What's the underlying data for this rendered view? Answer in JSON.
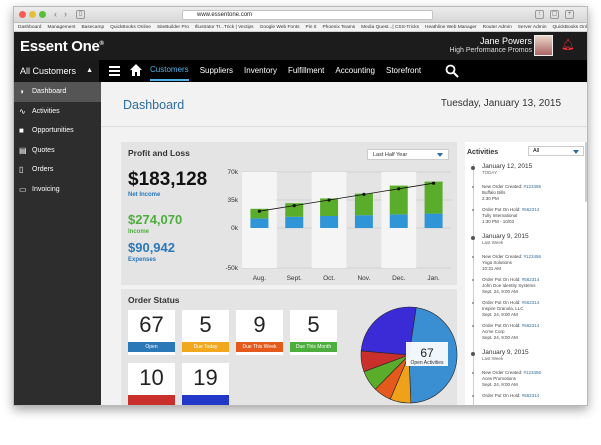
{
  "browser": {
    "url": "www.essentone.com",
    "bookmarks": [
      "Dashboard",
      "Management",
      "Basecamp",
      "QuickBooks Online",
      "SiteBuilder Pro",
      "Illustrator Tr...Trick | Vectips",
      "Google Web Fonts",
      "Pin It",
      "Phoenix Teams",
      "Media Quest...| CSS-Tricks",
      "Heathline Web Manager",
      "Router Admin",
      "Server Admin",
      "QuickBooks Online"
    ]
  },
  "header": {
    "logo": "Essent One",
    "logo_tm": "®",
    "user_name": "Jane Powers",
    "company": "High Performance Promos"
  },
  "nav": {
    "customer_select": "All Customers",
    "items": [
      {
        "label": "Customers",
        "active": true
      },
      {
        "label": "Suppliers"
      },
      {
        "label": "Inventory"
      },
      {
        "label": "Fulfillment"
      },
      {
        "label": "Accounting"
      },
      {
        "label": "Storefront"
      }
    ]
  },
  "sidebar": {
    "items": [
      {
        "label": "Dashboard",
        "icon": "dashboard-icon",
        "glyph": "◑"
      },
      {
        "label": "Activities",
        "icon": "activity-icon",
        "glyph": "∿"
      },
      {
        "label": "Opportunities",
        "icon": "briefcase-icon",
        "glyph": "■"
      },
      {
        "label": "Quotes",
        "icon": "quote-icon",
        "glyph": "▤"
      },
      {
        "label": "Orders",
        "icon": "orders-icon",
        "glyph": "▯"
      },
      {
        "label": "Invoicing",
        "icon": "invoice-icon",
        "glyph": "▭"
      }
    ]
  },
  "dashboard": {
    "title": "Dashboard",
    "date": "Tuesday, January 13, 2015"
  },
  "profit": {
    "title": "Profit and Loss",
    "period": "Last Half Year",
    "net_value": "$183,128",
    "net_label": "Net Income",
    "income_value": "$274,070",
    "income_label": "Income",
    "expense_value": "$90,942",
    "expense_label": "Expenses"
  },
  "chart_data": {
    "type": "bar",
    "categories": [
      "Aug.",
      "Sept.",
      "Oct.",
      "Nov.",
      "Dec.",
      "Jan."
    ],
    "yticks": [
      "70k",
      "35k",
      "0k",
      "-50k"
    ],
    "ylim": [
      -50,
      70
    ],
    "series": [
      {
        "name": "Expenses",
        "values": [
          12,
          14,
          15,
          16,
          17,
          18
        ]
      },
      {
        "name": "Income",
        "values": [
          12,
          17,
          22,
          27,
          36,
          40
        ]
      },
      {
        "name": "Net Income",
        "values": [
          9,
          14,
          20,
          26,
          32,
          38
        ]
      }
    ],
    "colors": {
      "income": "#5aad2b",
      "expenses": "#2f95d6",
      "net": "#111"
    }
  },
  "orders": {
    "title": "Order Status",
    "tiles": [
      {
        "n": "67",
        "label": "Open",
        "color": "#2b78b8"
      },
      {
        "n": "5",
        "label": "Due Today",
        "color": "#f2a81d"
      },
      {
        "n": "9",
        "label": "Due This Week",
        "color": "#e35a1c"
      },
      {
        "n": "5",
        "label": "Due This Month",
        "color": "#4cae3c"
      },
      {
        "n": "10",
        "label": "",
        "color": "#c9302c"
      },
      {
        "n": "19",
        "label": "",
        "color": "#2238c9"
      }
    ],
    "pie_center": {
      "n": "67",
      "label": "Open Activities"
    },
    "pie_colors": [
      "#3a8fd3",
      "#f0a11a",
      "#e35a1c",
      "#5aad2b",
      "#c9302c",
      "#3a2bd6"
    ]
  },
  "activities": {
    "title": "Activities",
    "filter": "All",
    "events": [
      {
        "date": "January 12, 2015",
        "sub": "TODAY",
        "items": [
          {
            "txt": "New Order Created: ",
            "id": "#123456",
            "meta": "Buffalo Bills",
            "time": "2:30 PM"
          },
          {
            "txt": "Order Put On Hold: ",
            "id": "#562314",
            "meta": "Tully International",
            "time": "1:30 PM - 10/03"
          }
        ]
      },
      {
        "date": "January 9, 2015",
        "sub": "Last Week",
        "items": [
          {
            "txt": "New Order Created: ",
            "id": "#123456",
            "meta": "Yoga Solutions",
            "time": "10:31 AM"
          },
          {
            "txt": "Order Put On Hold: ",
            "id": "#562314",
            "meta": "John Doe Identity Systems",
            "time": "Sept. 24, 9:00 AM"
          },
          {
            "txt": "Order Put On Hold: ",
            "id": "#562314",
            "meta": "Inspire Granola, LLC",
            "time": "Sept. 24, 9:00 AM"
          },
          {
            "txt": "Order Put On Hold: ",
            "id": "#562314",
            "meta": "Acme Corp",
            "time": "Sept. 24, 9:00 AM"
          }
        ]
      },
      {
        "date": "January 9, 2015",
        "sub": "Last Week",
        "items": [
          {
            "txt": "New Order Created: ",
            "id": "#123456",
            "meta": "Aces Promotions",
            "time": "Sept. 24, 9:00 AM"
          },
          {
            "txt": "Order Put On Hold: ",
            "id": "#562314",
            "meta": "",
            "time": ""
          }
        ]
      }
    ]
  }
}
